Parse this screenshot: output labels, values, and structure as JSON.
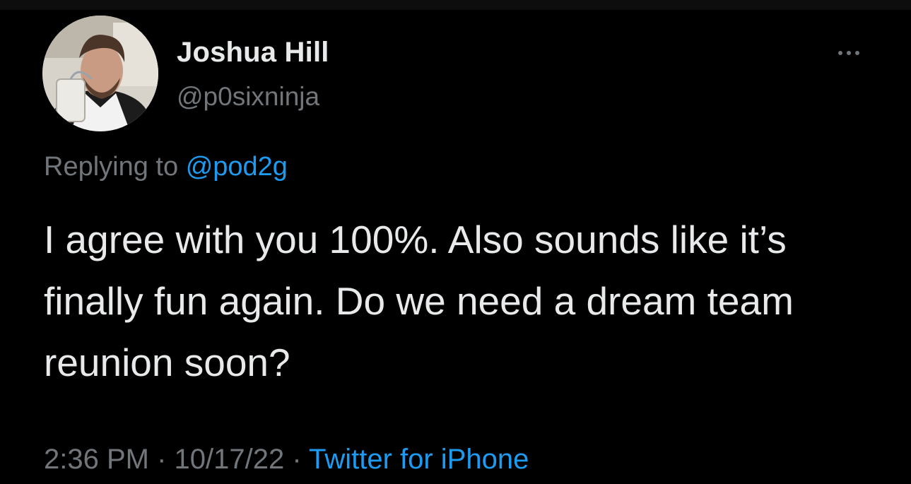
{
  "tweet": {
    "author": {
      "display_name": "Joshua Hill",
      "handle": "@p0sixninja"
    },
    "reply": {
      "prefix": "Replying to",
      "mention": "@pod2g"
    },
    "text": "I agree with you 100%. Also sounds like it’s finally fun again. Do we need a dream team reunion soon?",
    "meta": {
      "time": "2:36 PM",
      "separator": "·",
      "date": "10/17/22",
      "source": "Twitter for iPhone"
    }
  },
  "colors": {
    "background": "#000000",
    "primary_text": "#e7e9ea",
    "secondary_text": "#71767b",
    "accent": "#1d9bf0"
  },
  "icons": {
    "more": "more-horizontal-icon"
  }
}
